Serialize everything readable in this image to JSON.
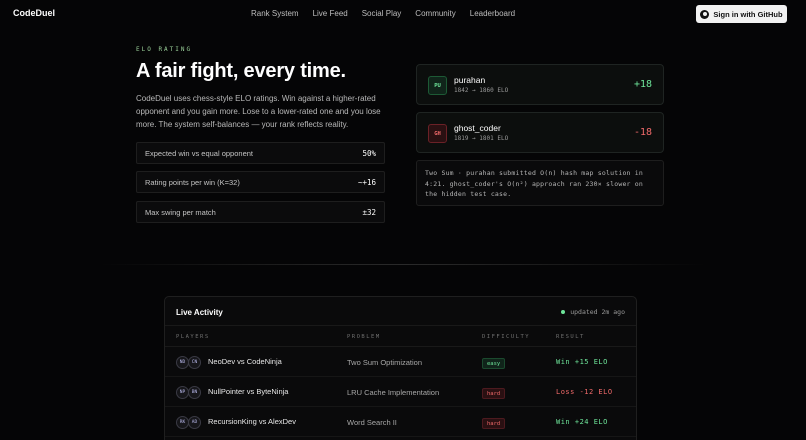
{
  "brand": "CodeDuel",
  "nav": [
    "Rank System",
    "Live Feed",
    "Social Play",
    "Community",
    "Leaderboard"
  ],
  "signin": {
    "label": "Sign in with GitHub",
    "icon": "github-icon"
  },
  "elo": {
    "eyebrow": "ELO RATING",
    "headline": "A fair fight, every time.",
    "description": "CodeDuel uses chess-style ELO ratings. Win against a higher-rated opponent and you gain more. Lose to a lower-rated one and you lose more. The system self-balances — your rank reflects reality.",
    "stats": [
      {
        "label": "Expected win vs equal opponent",
        "value": "50%"
      },
      {
        "label": "Rating points per win (K=32)",
        "value": "~+16"
      },
      {
        "label": "Max swing per match",
        "value": "±32"
      }
    ]
  },
  "duel": {
    "players": [
      {
        "initials": "PU",
        "name": "purahan",
        "elo": "1842 → 1860 ELO",
        "delta": "+18",
        "status": "up"
      },
      {
        "initials": "GH",
        "name": "ghost_coder",
        "elo": "1819 → 1801 ELO",
        "delta": "-18",
        "status": "down"
      }
    ],
    "log": "Two Sum · purahan submitted O(n) hash map solution in 4:21. ghost_coder's O(n²) approach ran 230× slower on the hidden test case."
  },
  "activity": {
    "title": "Live Activity",
    "updated": "updated 2m ago",
    "columns": [
      "PLAYERS",
      "PROBLEM",
      "DIFFICULTY",
      "RESULT"
    ],
    "rows": [
      {
        "a": "ND",
        "b": "CN",
        "players": "NeoDev vs CodeNinja",
        "problem": "Two Sum Optimization",
        "difficulty": "easy",
        "result": "Win  +15 ELO",
        "outcome": "win"
      },
      {
        "a": "NP",
        "b": "BN",
        "players": "NullPointer vs ByteNinja",
        "problem": "LRU Cache Implementation",
        "difficulty": "hard",
        "result": "Loss  -12 ELO",
        "outcome": "loss"
      },
      {
        "a": "RK",
        "b": "AD",
        "players": "RecursionKing vs AlexDev",
        "problem": "Word Search II",
        "difficulty": "hard",
        "result": "Win  +24 ELO",
        "outcome": "win"
      }
    ]
  },
  "colors": {
    "accent_green": "#6ee59a",
    "accent_red": "#f06a6a",
    "background": "#050506"
  }
}
